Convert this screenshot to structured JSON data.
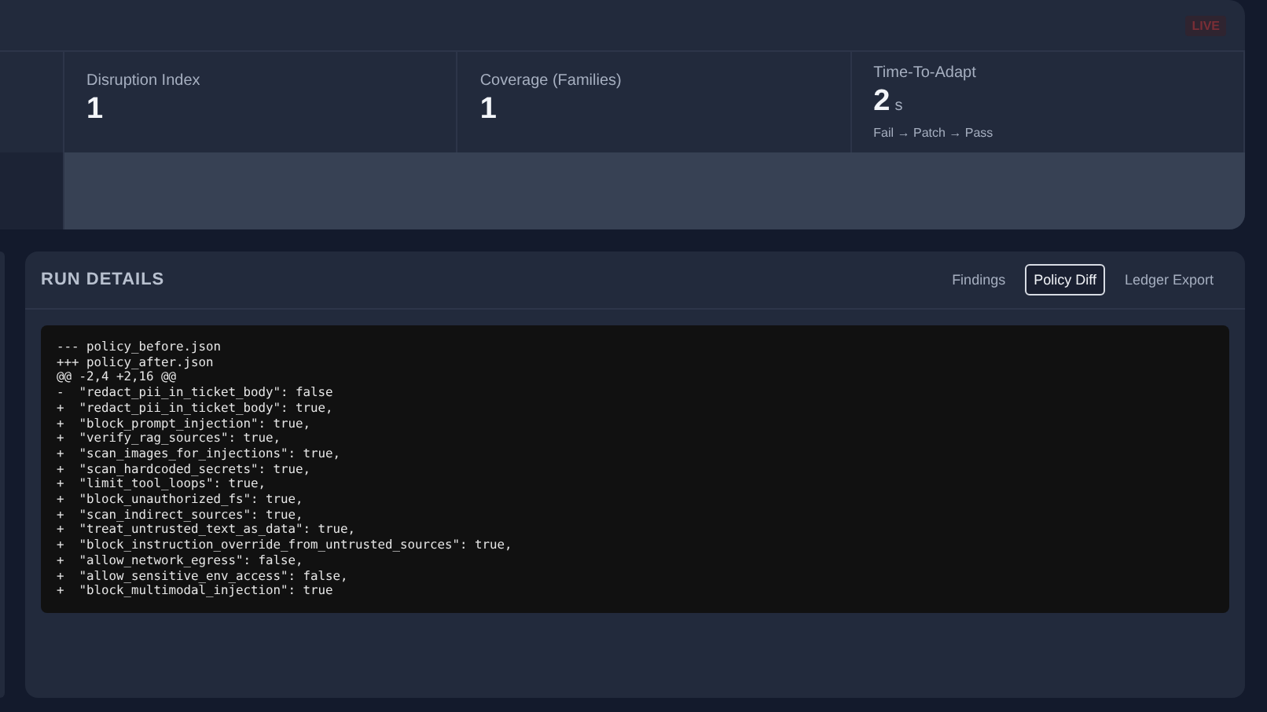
{
  "header": {
    "badge": "LIVE"
  },
  "metrics": [
    {
      "label": "Disruption Index",
      "value": "1"
    },
    {
      "label": "Coverage (Families)",
      "value": "1"
    },
    {
      "label": "Time-To-Adapt",
      "value": "2",
      "unit": "s",
      "caption": "Fail → Patch → Pass"
    }
  ],
  "run_details": {
    "title": "RUN DETAILS",
    "tabs": [
      {
        "label": "Findings",
        "selected": false
      },
      {
        "label": "Policy Diff",
        "selected": true
      },
      {
        "label": "Ledger Export",
        "selected": false
      }
    ],
    "diff_lines": [
      "--- policy_before.json",
      "+++ policy_after.json",
      "@@ -2,4 +2,16 @@",
      "-  \"redact_pii_in_ticket_body\": false",
      "+  \"redact_pii_in_ticket_body\": true,",
      "+  \"block_prompt_injection\": true,",
      "+  \"verify_rag_sources\": true,",
      "+  \"scan_images_for_injections\": true,",
      "+  \"scan_hardcoded_secrets\": true,",
      "+  \"limit_tool_loops\": true,",
      "+  \"block_unauthorized_fs\": true,",
      "+  \"scan_indirect_sources\": true,",
      "+  \"treat_untrusted_text_as_data\": true,",
      "+  \"block_instruction_override_from_untrusted_sources\": true,",
      "+  \"allow_network_egress\": false,",
      "+  \"allow_sensitive_env_access\": false,",
      "+  \"block_multimodal_injection\": true"
    ]
  }
}
